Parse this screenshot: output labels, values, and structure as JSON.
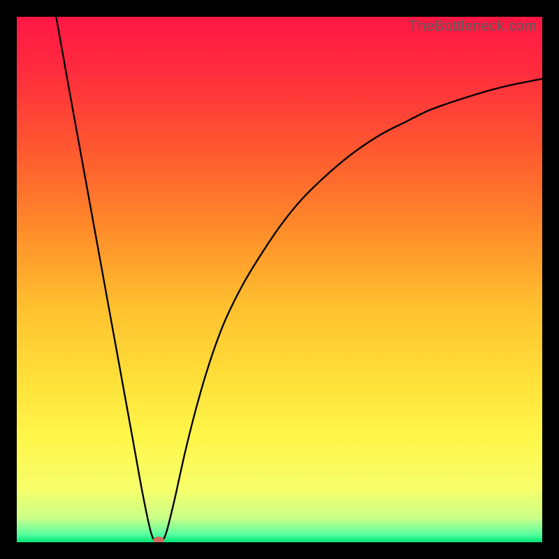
{
  "watermark": "TheBottleneck.com",
  "chart_data": {
    "type": "line",
    "title": "",
    "xlabel": "",
    "ylabel": "",
    "xlim": [
      0,
      100
    ],
    "ylim": [
      0,
      100
    ],
    "gradient_stops": [
      {
        "offset": 0.0,
        "color": "#ff1744"
      },
      {
        "offset": 0.1,
        "color": "#ff2b3e"
      },
      {
        "offset": 0.25,
        "color": "#ff5730"
      },
      {
        "offset": 0.4,
        "color": "#ff8a2a"
      },
      {
        "offset": 0.55,
        "color": "#ffc02e"
      },
      {
        "offset": 0.7,
        "color": "#ffe23a"
      },
      {
        "offset": 0.8,
        "color": "#fff64a"
      },
      {
        "offset": 0.9,
        "color": "#f6ff6a"
      },
      {
        "offset": 0.955,
        "color": "#c8ff88"
      },
      {
        "offset": 0.985,
        "color": "#58ffa0"
      },
      {
        "offset": 1.0,
        "color": "#00e676"
      }
    ],
    "series": [
      {
        "name": "bottleneck-curve",
        "color": "#000000",
        "x": [
          7.5,
          10,
          12,
          14,
          16,
          18,
          20,
          22,
          24,
          25.5,
          26.5,
          27.5,
          28.5,
          30,
          32,
          34,
          36,
          38,
          40,
          43,
          46,
          50,
          54,
          58,
          62,
          66,
          70,
          74,
          78,
          82,
          86,
          90,
          94,
          98,
          100
        ],
        "y": [
          100,
          86,
          75,
          64,
          53,
          42,
          31,
          20,
          9,
          2,
          0,
          0,
          2,
          8,
          17,
          25,
          32,
          38,
          43,
          49,
          54,
          60,
          65,
          69,
          72.5,
          75.5,
          78,
          80,
          82,
          83.5,
          84.8,
          86,
          87,
          87.8,
          88.2
        ]
      }
    ],
    "marker": {
      "name": "optimal-point",
      "x": 27,
      "y": 0,
      "color": "#d46a5a",
      "rx": 8,
      "ry": 5
    }
  }
}
